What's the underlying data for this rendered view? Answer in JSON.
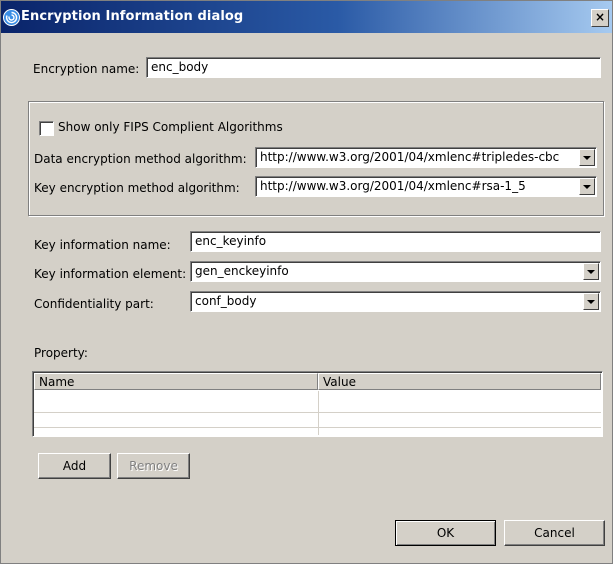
{
  "window": {
    "title": "Encryption Information dialog",
    "close_glyph": "×"
  },
  "encryption_name": {
    "label": "Encryption name:",
    "value": "enc_body"
  },
  "algorithms": {
    "fips_checkbox_label": "Show only FIPS Complient Algorithms",
    "fips_checked": false,
    "data_method": {
      "label": "Data encryption method algorithm:",
      "value": "http://www.w3.org/2001/04/xmlenc#tripledes-cbc"
    },
    "key_method": {
      "label": "Key encryption method algorithm:",
      "value": "http://www.w3.org/2001/04/xmlenc#rsa-1_5"
    }
  },
  "key_info_name": {
    "label": "Key information name:",
    "value": "enc_keyinfo"
  },
  "key_info_element": {
    "label": "Key information element:",
    "value": "gen_enckeyinfo"
  },
  "confidentiality_part": {
    "label": "Confidentiality part:",
    "value": "conf_body"
  },
  "property": {
    "label": "Property:",
    "columns": [
      "Name",
      "Value"
    ]
  },
  "buttons": {
    "add": "Add",
    "remove": "Remove",
    "ok": "OK",
    "cancel": "Cancel"
  },
  "icons": {
    "title": "eclipse-swirl-icon",
    "dropdown": "chevron-down-icon"
  }
}
